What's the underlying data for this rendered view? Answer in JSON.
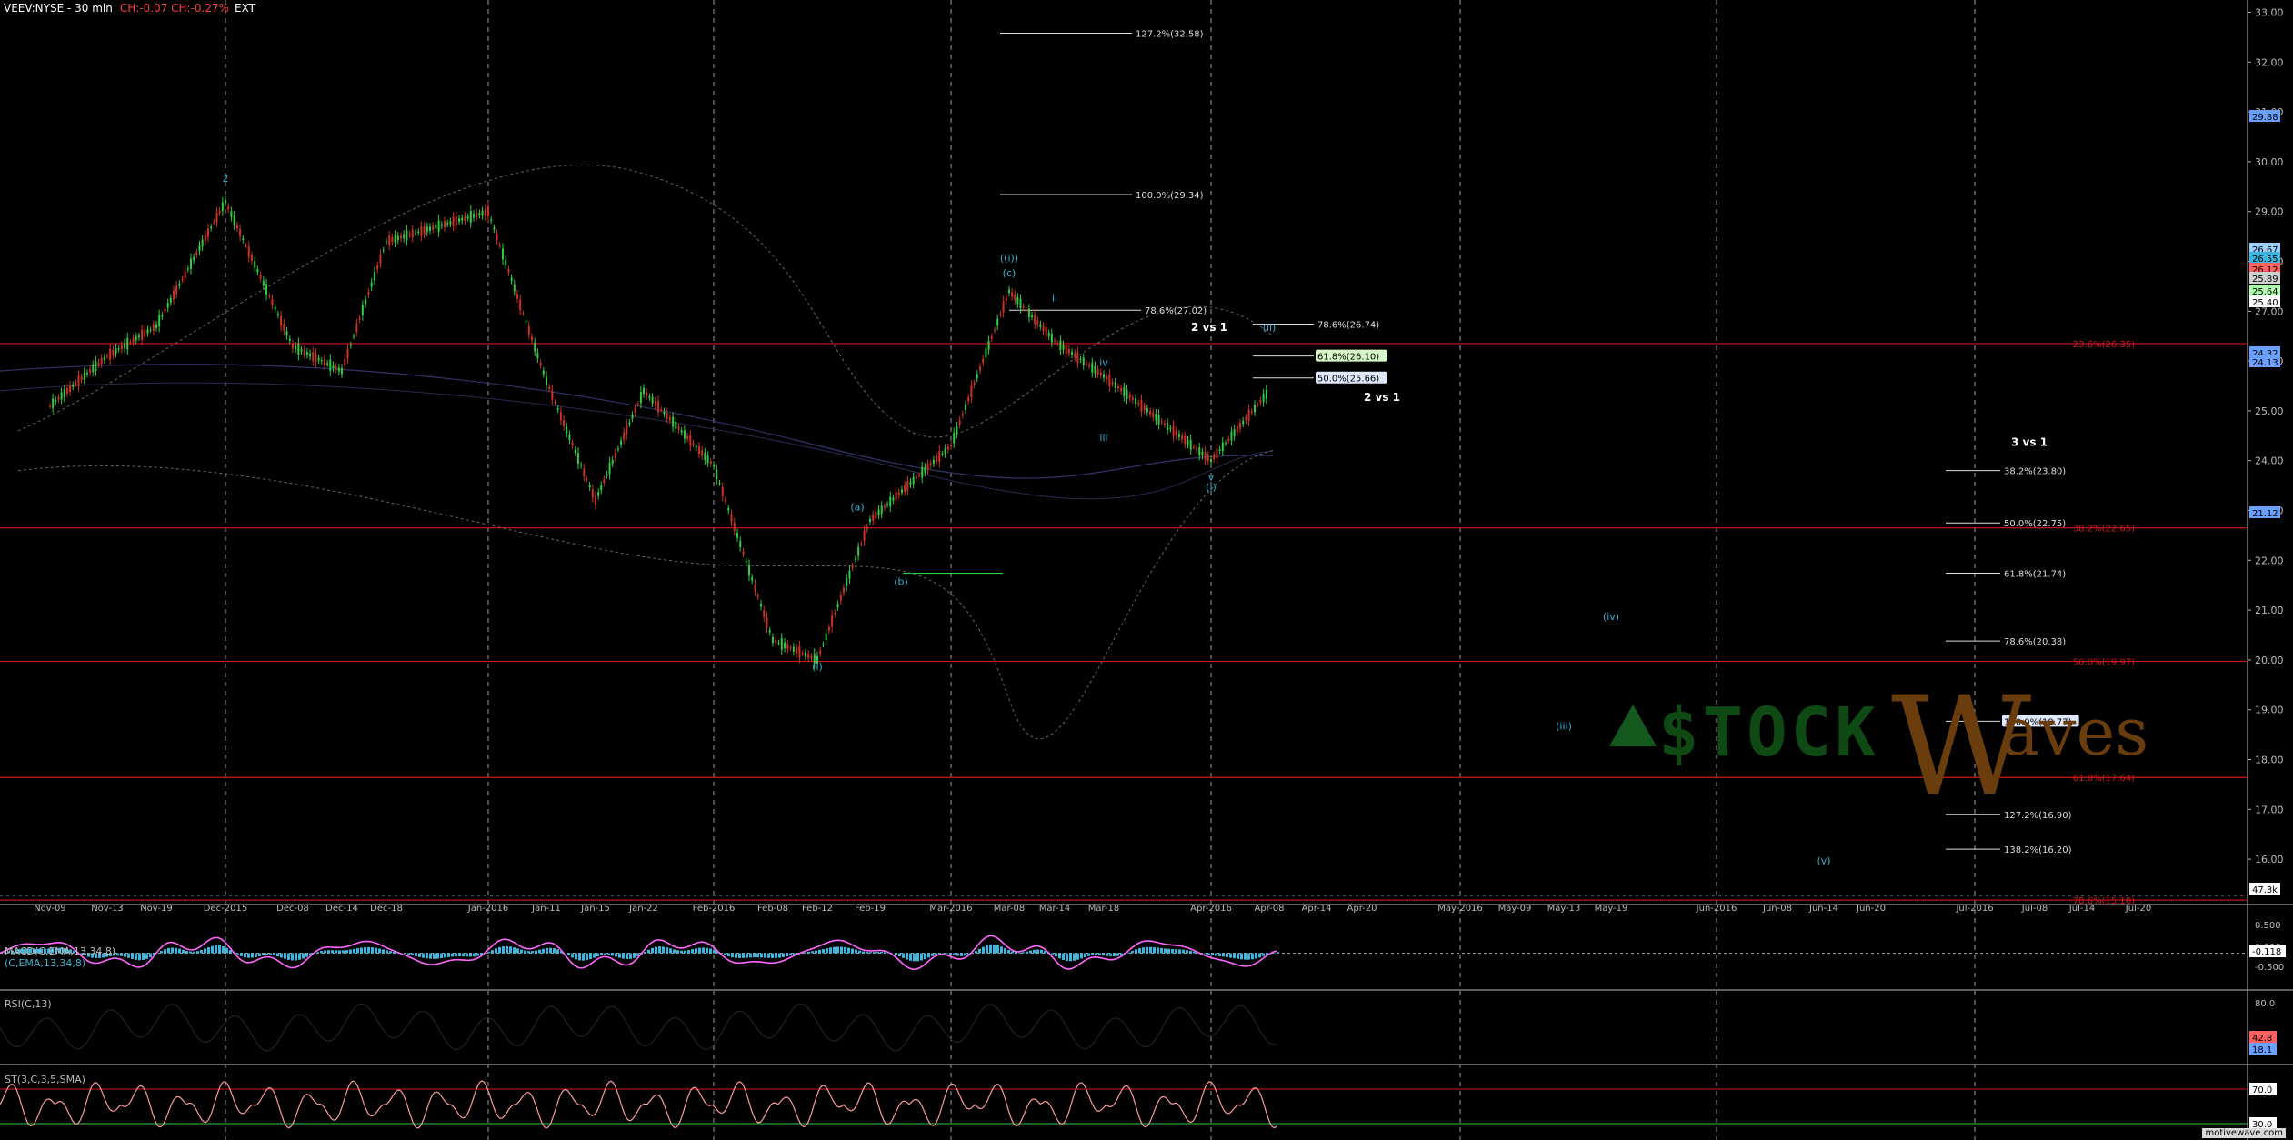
{
  "header": {
    "symbol": "VEEV:NYSE - 30 min",
    "change": "CH:-0.07  CH:-0.27%",
    "ext": "EXT"
  },
  "colors": {
    "bg": "#000000",
    "grid": "#9a9a9a",
    "fib_red": "#d01818",
    "wave_cyan": "#38b0d0",
    "candle_up": "#2ecc40",
    "candle_down": "#d03020",
    "macd_line": "#ff66ff",
    "macd_hist": "#3cb8e0",
    "stoch": "#ff9a9a",
    "panel_sep": "#bbbbbb"
  },
  "chart_data": {
    "type": "line",
    "title": "VEEV:NYSE - 30 min",
    "price_range": [
      15.4,
      33.1
    ],
    "price_ticks": [
      "33.00",
      "32.00",
      "31.00",
      "30.00",
      "29.00",
      "28.00",
      "27.00",
      "26.00",
      "25.00",
      "24.00",
      "23.00",
      "22.00",
      "21.00",
      "20.00",
      "19.00",
      "18.00",
      "17.00",
      "16.00"
    ],
    "x_labels": [
      "Nov-09",
      "Nov-13",
      "Nov-19",
      "Dec-2015",
      "Dec-08",
      "Dec-14",
      "Dec-18",
      "Jan-2016",
      "Jan-11",
      "Jan-15",
      "Jan-22",
      "Feb-2016",
      "Feb-08",
      "Feb-12",
      "Feb-19",
      "Mar-2016",
      "Mar-08",
      "Mar-14",
      "Mar-18",
      "Apr-2016",
      "Apr-08",
      "Apr-14",
      "Apr-20",
      "May-2016",
      "May-09",
      "May-13",
      "May-19",
      "Jun-2016",
      "Jun-08",
      "Jun-14",
      "Jun-20",
      "Jul-2016",
      "Jul-08",
      "Jul-14",
      "Jul-20"
    ],
    "price_path": [
      [
        "Nov-09",
        25.1
      ],
      [
        "Nov-13",
        26.1
      ],
      [
        "Nov-19",
        26.7
      ],
      [
        "Dec-2015",
        29.2
      ],
      [
        "Dec-08",
        26.3
      ],
      [
        "Dec-14",
        25.8
      ],
      [
        "Dec-18",
        28.4
      ],
      [
        "Jan-2016",
        29.0
      ],
      [
        "Jan-11",
        25.6
      ],
      [
        "Jan-15",
        23.2
      ],
      [
        "Jan-22",
        25.4
      ],
      [
        "Feb-2016",
        23.9
      ],
      [
        "Feb-08",
        20.4
      ],
      [
        "Feb-12",
        20.0
      ],
      [
        "Feb-19",
        22.8
      ],
      [
        "Mar-2016",
        24.3
      ],
      [
        "Mar-08",
        27.4
      ],
      [
        "Mar-14",
        26.4
      ],
      [
        "Mar-18",
        25.7
      ],
      [
        "Apr-2016",
        24.0
      ],
      [
        "Apr-08",
        25.4
      ]
    ],
    "fib_lines_red": [
      {
        "label": "23.6%(26.35)",
        "price": 26.35
      },
      {
        "label": "38.2%(22.65)",
        "price": 22.65
      },
      {
        "label": "50.0%(19.97)",
        "price": 19.97
      },
      {
        "label": "61.8%(17.64)",
        "price": 17.64
      },
      {
        "label": "78.6%(15.18)",
        "price": 15.18
      }
    ],
    "fib_levels_white": [
      {
        "label": "127.2%(32.58)",
        "price": 32.58
      },
      {
        "label": "100.0%(29.34)",
        "price": 29.34
      },
      {
        "label": "78.6%(27.02)",
        "price": 27.02
      },
      {
        "label": "78.6%(26.74)",
        "price": 26.74
      },
      {
        "label": "61.8%(26.10)",
        "price": 26.1
      },
      {
        "label": "50.0%(25.66)",
        "price": 25.66
      },
      {
        "label": "38.2%(23.80)",
        "price": 23.8
      },
      {
        "label": "50.0%(22.75)",
        "price": 22.75
      },
      {
        "label": "61.8%(21.74)",
        "price": 21.74
      },
      {
        "label": "78.6%(20.38)",
        "price": 20.38
      },
      {
        "label": "100.0%(18.77)",
        "price": 18.77
      },
      {
        "label": "127.2%(16.90)",
        "price": 16.9
      },
      {
        "label": "138.2%(16.20)",
        "price": 16.2
      }
    ],
    "wave_labels": [
      {
        "text": "2",
        "date": "Dec-2015",
        "price": 29.6
      },
      {
        "text": "(i)",
        "date": "Feb-12",
        "price": 19.8
      },
      {
        "text": "(a)",
        "date": "Feb-19",
        "price": 23.0
      },
      {
        "text": "(b)",
        "date": "Feb-19",
        "price": 21.5
      },
      {
        "text": "((i))",
        "date": "Mar-08",
        "price": 28.0
      },
      {
        "text": "(c)",
        "date": "Mar-08",
        "price": 27.7
      },
      {
        "text": "ii",
        "date": "Mar-14",
        "price": 27.2
      },
      {
        "text": "iii",
        "date": "Mar-18",
        "price": 24.4
      },
      {
        "text": "iv",
        "date": "Mar-18",
        "price": 25.9
      },
      {
        "text": "v",
        "date": "Apr-2016",
        "price": 23.6
      },
      {
        "text": "(i)",
        "date": "Apr-2016",
        "price": 23.4
      },
      {
        "text": "(ii)",
        "date": "Apr-08",
        "price": 26.6
      },
      {
        "text": "(iii)",
        "date": "May-13",
        "price": 18.6
      },
      {
        "text": "(iv)",
        "date": "May-19",
        "price": 20.8
      },
      {
        "text": "(v)",
        "date": "Jun-14",
        "price": 15.9
      }
    ],
    "annotations": [
      "2 vs 1",
      "2 vs 1",
      "3 vs 1"
    ],
    "price_tags": [
      "29.88",
      "26.67",
      "26.55",
      "26.12",
      "25.89",
      "25.64",
      "25.40",
      "24.32",
      "24.13",
      "21.12",
      "47.3k"
    ],
    "macd": {
      "label": "MACD(C,EMA,13,34,8)",
      "sub": "(C,EMA,13,34,8)",
      "ticks": [
        "0.500",
        "0.000",
        "-0.500"
      ],
      "value": "-0.118"
    },
    "rsi": {
      "label": "RSI(C,13)",
      "ticks": [
        "80.0",
        "20.0"
      ],
      "tags": [
        "42.8",
        "18.1"
      ]
    },
    "stoch": {
      "label": "ST(3,C,3,5,SMA)",
      "tags": [
        "70.0",
        "30.0"
      ]
    }
  },
  "footer": {
    "site": "motivewave.com"
  }
}
